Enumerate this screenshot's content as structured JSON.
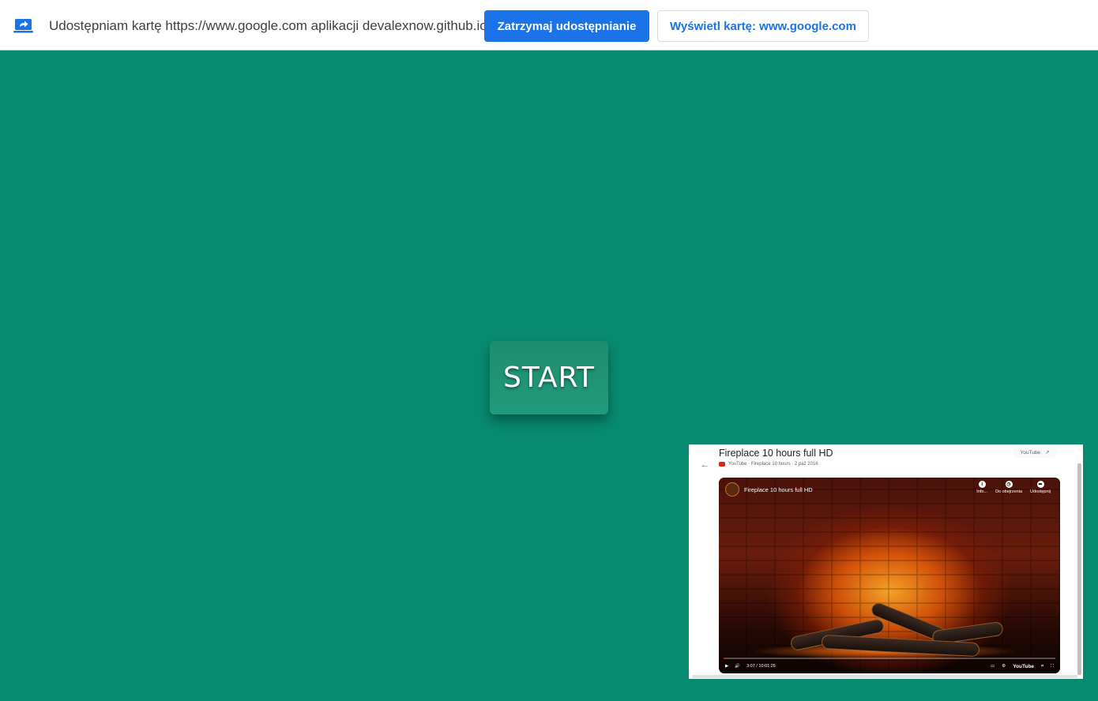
{
  "infobar": {
    "icon": "screen-share-icon",
    "message": "Udostępniam kartę https://www.google.com aplikacji devalexnow.github.io",
    "stop_label": "Zatrzymaj udostępnianie",
    "view_label": "Wyświetl kartę: www.google.com",
    "accent_color": "#1a73e8"
  },
  "page": {
    "background_color": "#088a70",
    "start_label": "START"
  },
  "preview": {
    "title": "Fireplace 10 hours full HD",
    "subtitle": "YouTube · Fireplace 10 hours · 2 paź 2016",
    "source_chip": "YouTube",
    "video": {
      "title": "Fireplace 10 hours full HD",
      "actions": [
        {
          "icon": "info-icon",
          "label": "Info..."
        },
        {
          "icon": "clock-icon",
          "label": "Do obejrzenia"
        },
        {
          "icon": "share-icon",
          "label": "Udostępnij"
        }
      ],
      "time": "3:07 / 10:01:25",
      "progress": 0.005,
      "brand": "YouTube"
    }
  }
}
